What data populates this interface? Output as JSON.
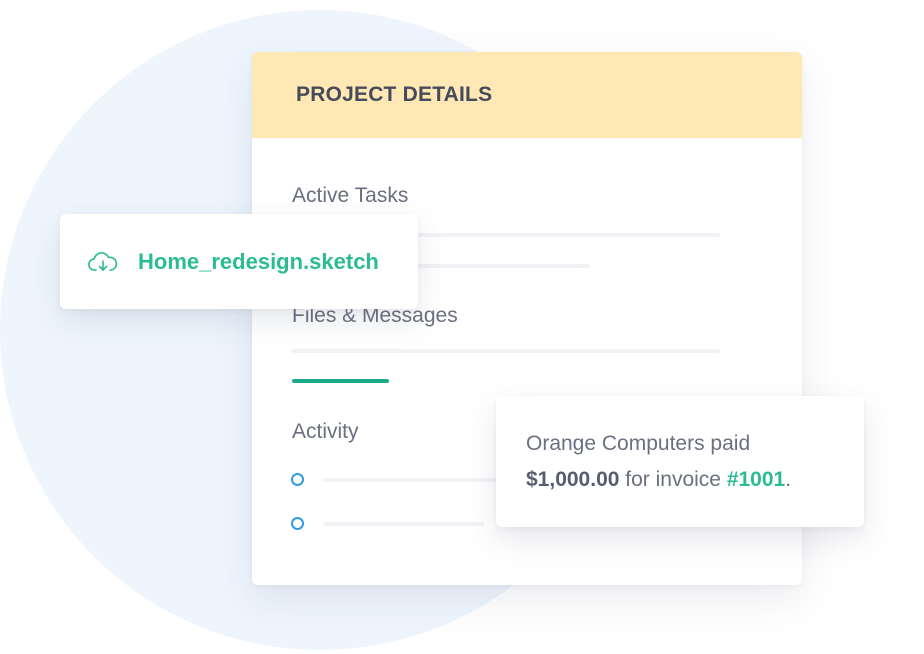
{
  "project_card": {
    "title": "PROJECT DETAILS",
    "sections": {
      "active_tasks": "Active Tasks",
      "files_messages": "Files & Messages",
      "activity": "Activity"
    }
  },
  "file_card": {
    "icon": "cloud-download-icon",
    "file_name": "Home_redesign.sketch"
  },
  "notification": {
    "line1": "Orange Computers paid",
    "amount": "$1,000.00",
    "middle": " for invoice ",
    "invoice": "#1001",
    "end": "."
  },
  "colors": {
    "header_bg": "#ffe8b3",
    "accent_green": "#2bbc93",
    "tab_indicator": "#1bab8b",
    "dot_blue": "#2f9be0",
    "circle_bg": "#eef5fd"
  }
}
